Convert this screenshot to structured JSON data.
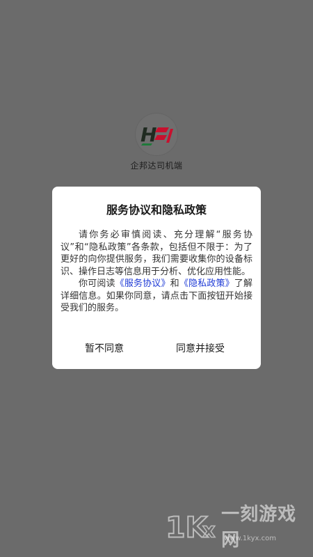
{
  "app": {
    "name": "企邦达司机端",
    "logo_text": "H"
  },
  "dialog": {
    "title": "服务协议和隐私政策",
    "paragraph1": "请你务必审慎阅读、充分理解“服务协议”和“隐私政策”各条款，包括但不限于：为了更好的向你提供服务，我们需要收集你的设备标识、操作日志等信息用于分析、优化应用性能。",
    "p2_prefix": "你可阅读",
    "service_link": "《服务协议》",
    "p2_and": "和",
    "privacy_link": "《隐私政策》",
    "p2_suffix": "了解详细信息。如果你同意，请点击下面按钮开始接受我们的服务。",
    "decline_label": "暂不同意",
    "accept_label": "同意并接受"
  },
  "watermark": {
    "brand": "一刻游戏网",
    "url": "www.1kyx.com"
  },
  "colors": {
    "overlay": "#6b6b6b",
    "dialog_bg": "#ffffff",
    "link": "#1e3ad6",
    "logo_red": "#c8102e",
    "logo_green": "#1f7a3a"
  }
}
